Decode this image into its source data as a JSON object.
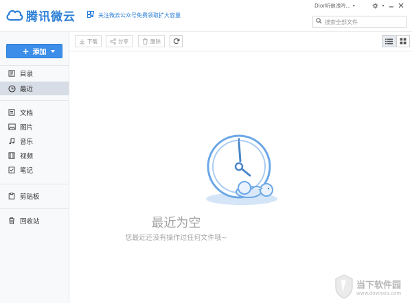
{
  "app": {
    "brand": "腾讯微云"
  },
  "header": {
    "promo_text": "关注微云公众号免费领取扩大容量",
    "user_label": "Dior听他浅吟...",
    "search_placeholder": "搜索全部文件"
  },
  "sidebar": {
    "add_label": "添加",
    "items": [
      {
        "label": "目录",
        "icon": "directory-icon"
      },
      {
        "label": "最近",
        "icon": "clock-icon",
        "active": true
      },
      {
        "label": "文档",
        "icon": "document-icon"
      },
      {
        "label": "图片",
        "icon": "image-icon"
      },
      {
        "label": "音乐",
        "icon": "music-icon"
      },
      {
        "label": "视频",
        "icon": "video-icon"
      },
      {
        "label": "笔记",
        "icon": "note-icon"
      },
      {
        "label": "剪贴板",
        "icon": "clipboard-icon"
      },
      {
        "label": "回收站",
        "icon": "trash-icon"
      }
    ]
  },
  "toolbar": {
    "download_label": "下载",
    "share_label": "分享",
    "delete_label": "删除"
  },
  "empty_state": {
    "title": "最近为空",
    "subtitle": "您最近还没有操作过任何文件哦~"
  },
  "watermark": {
    "title": "当下软件园",
    "url": "www.downxia.com"
  },
  "colors": {
    "accent": "#3d8ee8",
    "active_bg": "#d7dde6"
  }
}
